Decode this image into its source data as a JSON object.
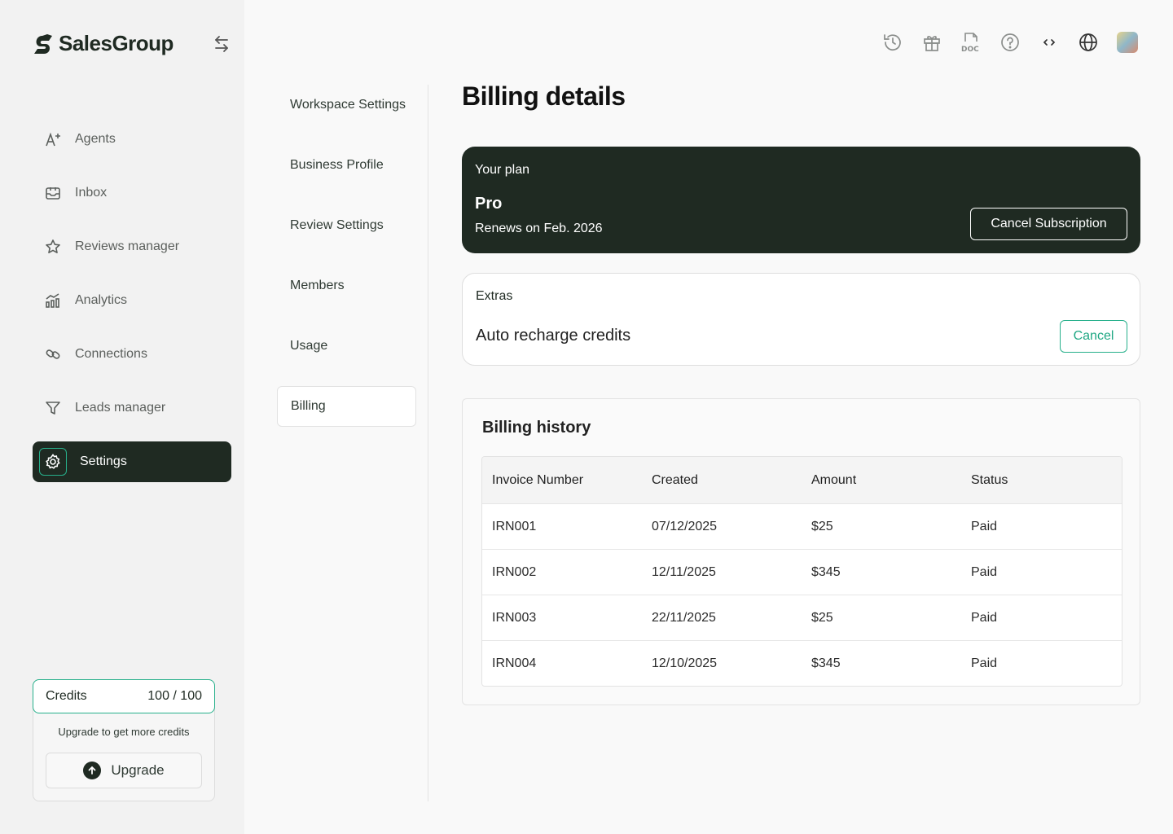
{
  "brand": {
    "name": "SalesGroup"
  },
  "sidebar": {
    "items": [
      {
        "label": "Agents",
        "icon": "ai-sparkle-icon"
      },
      {
        "label": "Inbox",
        "icon": "inbox-icon"
      },
      {
        "label": "Reviews manager",
        "icon": "star-icon"
      },
      {
        "label": "Analytics",
        "icon": "analytics-icon"
      },
      {
        "label": "Connections",
        "icon": "link-icon"
      },
      {
        "label": "Leads manager",
        "icon": "funnel-icon"
      },
      {
        "label": "Settings",
        "icon": "gear-icon",
        "active": true
      }
    ],
    "credits": {
      "label": "Credits",
      "value": "100 / 100",
      "note": "Upgrade to get more credits",
      "upgrade_label": "Upgrade"
    }
  },
  "subnav": {
    "items": [
      "Workspace Settings",
      "Business Profile",
      "Review Settings",
      "Members",
      "Usage",
      "Billing"
    ],
    "active": "Billing"
  },
  "topbar": {
    "icons": [
      "history-icon",
      "gift-icon",
      "doc-icon",
      "help-icon",
      "code-icon",
      "globe-icon",
      "user-avatar"
    ]
  },
  "main": {
    "title": "Billing details",
    "plan": {
      "label": "Your plan",
      "name": "Pro",
      "renews": "Renews on Feb. 2026",
      "cancel_label": "Cancel Subscription"
    },
    "extras": {
      "label": "Extras",
      "item": "Auto recharge credits",
      "cancel_label": "Cancel"
    },
    "history": {
      "title": "Billing history",
      "columns": [
        "Invoice Number",
        "Created",
        "Amount",
        "Status"
      ],
      "rows": [
        [
          "IRN001",
          "07/12/2025",
          "$25",
          "Paid"
        ],
        [
          "IRN002",
          "12/11/2025",
          "$345",
          "Paid"
        ],
        [
          "IRN003",
          "22/11/2025",
          "$25",
          "Paid"
        ],
        [
          "IRN004",
          "12/10/2025",
          "$345",
          "Paid"
        ]
      ]
    }
  },
  "colors": {
    "dark": "#1f2a22",
    "accent": "#27b08b",
    "background": "#f9f9f9",
    "sidebar": "#f2f2f2"
  }
}
